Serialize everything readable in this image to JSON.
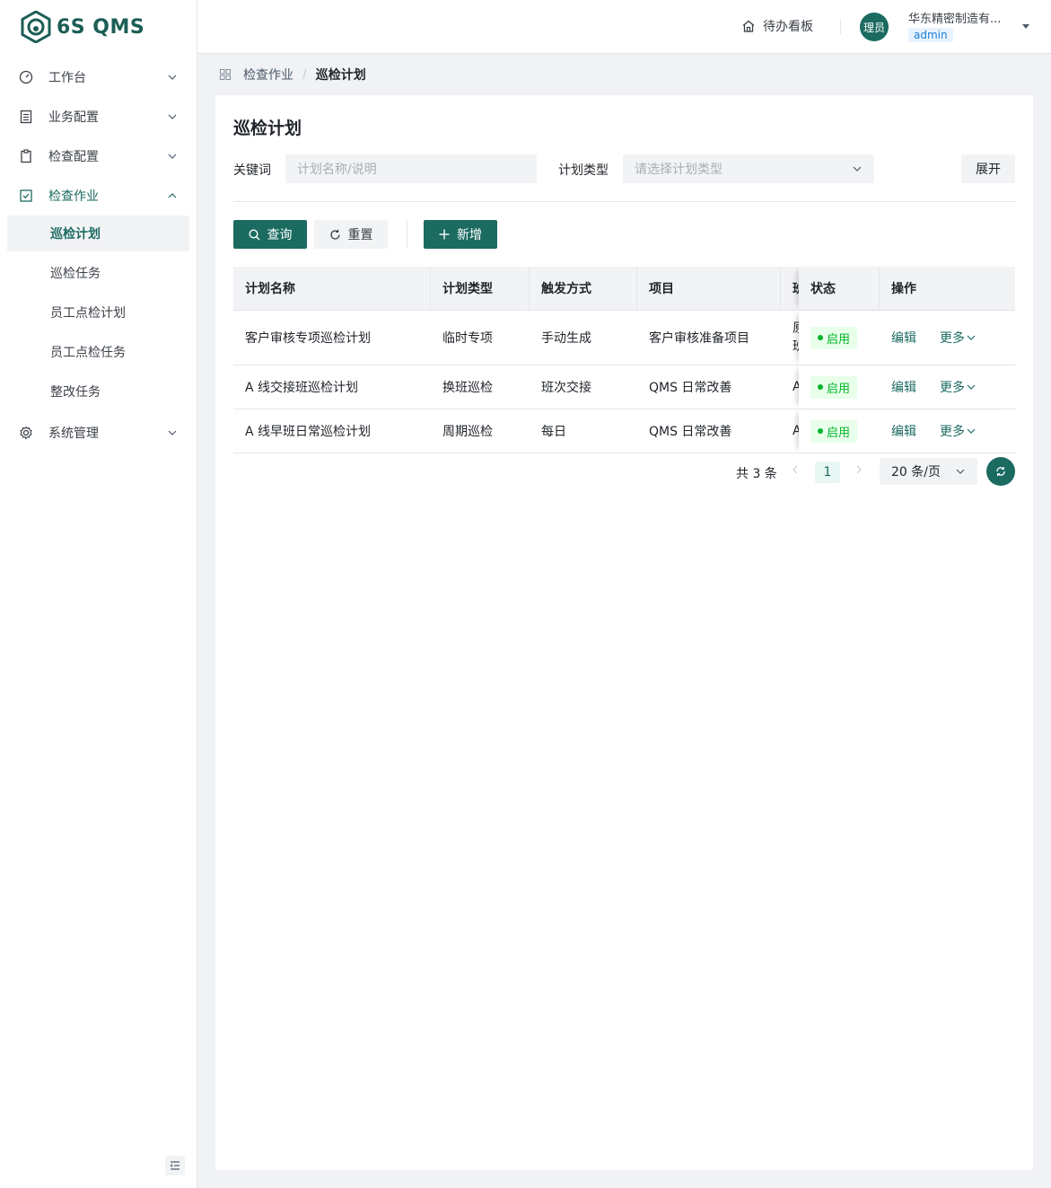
{
  "app": {
    "logo_text": "6S QMS"
  },
  "sidebar": {
    "items": [
      {
        "label": "工作台",
        "icon": "dashboard-icon"
      },
      {
        "label": "业务配置",
        "icon": "list-icon"
      },
      {
        "label": "检查配置",
        "icon": "clipboard-icon"
      },
      {
        "label": "检查作业",
        "icon": "checkbox-icon",
        "expanded": true
      },
      {
        "label": "系统管理",
        "icon": "gear-icon"
      }
    ],
    "subitems": [
      {
        "label": "巡检计划",
        "selected": true
      },
      {
        "label": "巡检任务"
      },
      {
        "label": "员工点检计划"
      },
      {
        "label": "员工点检任务"
      },
      {
        "label": "整改任务"
      }
    ]
  },
  "header": {
    "todo_label": "待办看板",
    "avatar_text": "理员",
    "company": "华东精密制造有...",
    "role": "admin"
  },
  "breadcrumb": {
    "parent": "检查作业",
    "current": "巡检计划"
  },
  "page": {
    "title": "巡检计划",
    "filters": {
      "keyword_label": "关键词",
      "keyword_placeholder": "计划名称/说明",
      "type_label": "计划类型",
      "type_placeholder": "请选择计划类型",
      "expand_label": "展开"
    },
    "buttons": {
      "query": "查询",
      "reset": "重置",
      "add": "新增"
    }
  },
  "table": {
    "columns": [
      "计划名称",
      "计划类型",
      "触发方式",
      "项目",
      "班",
      "状态",
      "操作"
    ],
    "rows": [
      {
        "name": "客户审核专项巡检计划",
        "type": "临时专项",
        "trigger": "手动生成",
        "project": "客户审核准备项目",
        "partial": "原\n班",
        "status": "启用",
        "edit": "编辑",
        "more": "更多"
      },
      {
        "name": "A 线交接班巡检计划",
        "type": "换班巡检",
        "trigger": "班次交接",
        "project": "QMS 日常改善",
        "partial": "A",
        "status": "启用",
        "edit": "编辑",
        "more": "更多"
      },
      {
        "name": "A 线早班日常巡检计划",
        "type": "周期巡检",
        "trigger": "每日",
        "project": "QMS 日常改善",
        "partial": "A",
        "status": "启用",
        "edit": "编辑",
        "more": "更多"
      }
    ]
  },
  "pagination": {
    "total": "共 3 条",
    "current_page": "1",
    "page_size": "20 条/页"
  },
  "colors": {
    "brand": "#1b6b61",
    "status_green": "#00b42a",
    "tag_blue": "#1c7ed6"
  }
}
